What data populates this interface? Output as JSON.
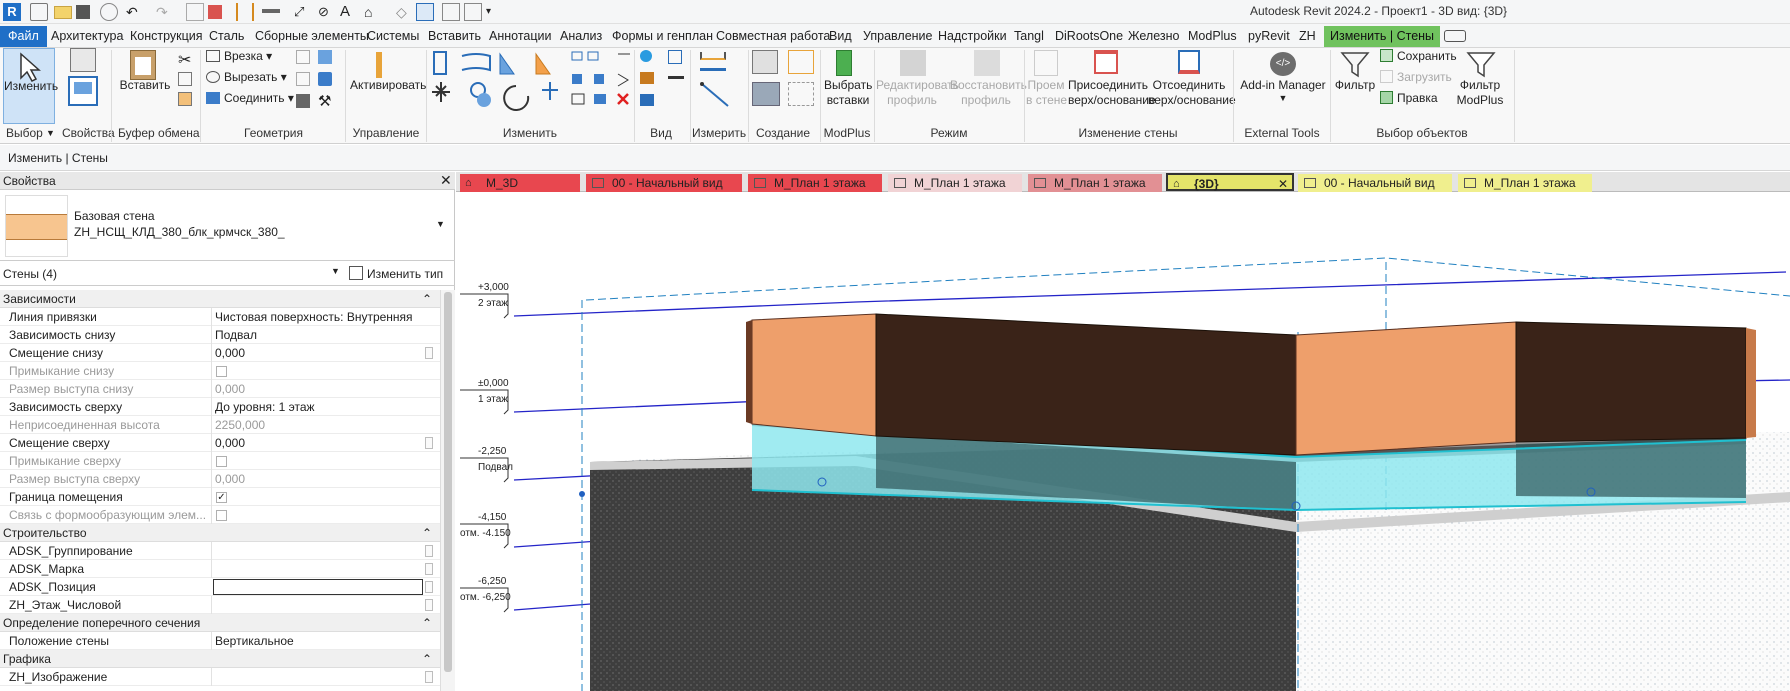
{
  "app": {
    "title": "Autodesk Revit 2024.2 - Проект1 - 3D вид: {3D}"
  },
  "ribbon_tabs": [
    {
      "label": "Файл"
    },
    {
      "label": "Архитектура"
    },
    {
      "label": "Конструкция"
    },
    {
      "label": "Сталь"
    },
    {
      "label": "Сборные элементы"
    },
    {
      "label": "Системы"
    },
    {
      "label": "Вставить"
    },
    {
      "label": "Аннотации"
    },
    {
      "label": "Анализ"
    },
    {
      "label": "Формы и генплан"
    },
    {
      "label": "Совместная работа"
    },
    {
      "label": "Вид"
    },
    {
      "label": "Управление"
    },
    {
      "label": "Надстройки"
    },
    {
      "label": "Tangl"
    },
    {
      "label": "DiRootsOne"
    },
    {
      "label": "Железно"
    },
    {
      "label": "ModPlus"
    },
    {
      "label": "pyRevit"
    },
    {
      "label": "ZH"
    },
    {
      "label": "Изменить | Стены"
    }
  ],
  "ribbon": {
    "modify": "Изменить",
    "select": "Выбор",
    "properties": "Свойства",
    "paste": "Вставить",
    "clipboard": "Буфер обмена",
    "cope": "Врезка",
    "cut": "Вырезать",
    "join": "Соединить",
    "geometry": "Геометрия",
    "activate": "Активировать",
    "control": "Управление",
    "modify_panel": "Изменить",
    "view_panel": "Вид",
    "measure": "Измерить",
    "create": "Создание",
    "pick_inserts_1": "Выбрать",
    "pick_inserts_2": "вставки",
    "modplus": "ModPlus",
    "edit_profile_1": "Редактировать",
    "edit_profile_2": "профиль",
    "reset_profile_1": "Восстановить",
    "reset_profile_2": "профиль",
    "mode": "Режим",
    "opening_1": "Проем",
    "opening_2": "в стене",
    "attach_1": "Присоединить",
    "attach_2": "верх/основание",
    "detach_1": "Отсоединить",
    "detach_2": "верх/основание",
    "modify_wall": "Изменение стены",
    "addin_manager": "Add-in Manager",
    "external_tools": "External Tools",
    "filter": "Фильтр",
    "save": "Сохранить",
    "load": "Загрузить",
    "edit": "Правка",
    "filter_modplus_1": "Фильтр",
    "filter_modplus_2": "ModPlus",
    "selection": "Выбор объектов"
  },
  "context_bar": {
    "label": "Изменить | Стены"
  },
  "properties": {
    "title": "Свойства",
    "type_family": "Базовая стена",
    "type_name": "ZH_НСЩ_КЛД_380_блк_крмчск_380_",
    "instance_filter": "Стены (4)",
    "edit_type": "Изменить тип",
    "groups": [
      {
        "name": "Зависимости",
        "rows": [
          {
            "name": "Линия привязки",
            "value": "Чистовая поверхность: Внутренняя"
          },
          {
            "name": "Зависимость снизу",
            "value": "Подвал"
          },
          {
            "name": "Смещение снизу",
            "value": "0,000"
          },
          {
            "name": "Примыкание снизу",
            "value": ""
          },
          {
            "name": "Размер выступа снизу",
            "value": "0,000"
          },
          {
            "name": "Зависимость сверху",
            "value": "До уровня: 1 этаж"
          },
          {
            "name": "Неприсоединенная высота",
            "value": "2250,000"
          },
          {
            "name": "Смещение сверху",
            "value": "0,000"
          },
          {
            "name": "Примыкание сверху",
            "value": ""
          },
          {
            "name": "Размер выступа сверху",
            "value": "0,000"
          },
          {
            "name": "Граница помещения",
            "value": ""
          },
          {
            "name": "Связь с формообразующим элем...",
            "value": ""
          }
        ]
      },
      {
        "name": "Строительство",
        "rows": [
          {
            "name": "ADSK_Группирование",
            "value": ""
          },
          {
            "name": "ADSK_Марка",
            "value": ""
          },
          {
            "name": "ADSK_Позиция",
            "value": ""
          },
          {
            "name": "ZH_Этаж_Числовой",
            "value": ""
          }
        ]
      },
      {
        "name": "Определение поперечного сечения",
        "rows": [
          {
            "name": "Положение стены",
            "value": "Вертикальное"
          }
        ]
      },
      {
        "name": "Графика",
        "rows": [
          {
            "name": "ZH_Изображение",
            "value": ""
          }
        ]
      }
    ]
  },
  "view_tabs": [
    {
      "label": "М_3D",
      "color": "#e8474f"
    },
    {
      "label": "00 - Начальный вид",
      "color": "#e8474f"
    },
    {
      "label": "М_План 1 этажа",
      "color": "#e8474f"
    },
    {
      "label": "М_План 1 этажа",
      "color": "#f1d3d5"
    },
    {
      "label": "М_План 1 этажа",
      "color": "#e29094"
    },
    {
      "label": "{3D}",
      "color": "#e4e46a"
    },
    {
      "label": "00 - Начальный вид",
      "color": "#f0ef8e"
    },
    {
      "label": "М_План 1 этажа",
      "color": "#f0ef8e"
    }
  ],
  "levels": [
    {
      "elev": "+3,000",
      "name": "2 этаж"
    },
    {
      "elev": "±0,000",
      "name": "1 этаж"
    },
    {
      "elev": "-2,250",
      "name": "Подвал"
    },
    {
      "elev": "-4,150",
      "name": "отм. -4.150"
    },
    {
      "elev": "-6,250",
      "name": "отм. -6,250"
    }
  ],
  "colors": {
    "file_tab": "#1f6fc7",
    "context_tab": "#70c25e",
    "brick": "#ee9f6b",
    "dark_wall": "#3a2318",
    "glass": "#8fe8ee"
  }
}
